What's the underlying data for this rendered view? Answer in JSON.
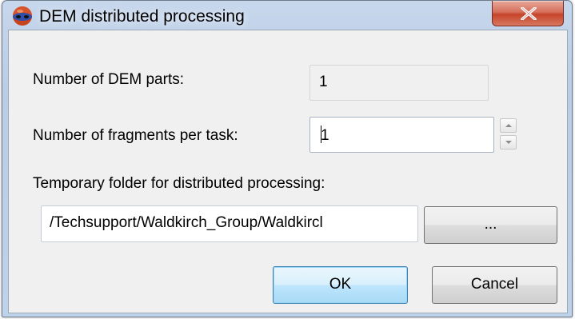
{
  "window": {
    "title": "DEM distributed processing",
    "close_symbol": "X"
  },
  "form": {
    "dem_parts_label": "Number of DEM parts:",
    "dem_parts_value": "1",
    "fragments_label": "Number of fragments per task:",
    "fragments_value": "1",
    "temp_folder_label": "Temporary folder for distributed processing:",
    "temp_folder_value": "/Techsupport/Waldkirch_Group/Waldkircl"
  },
  "buttons": {
    "browse_label": "...",
    "ok_label": "OK",
    "cancel_label": "Cancel"
  },
  "icons": {
    "app": "dem-globe-icon",
    "close": "close-icon",
    "spin_up": "spin-up-arrow-icon",
    "spin_down": "spin-down-arrow-icon"
  },
  "colors": {
    "title_gradient_top": "#c7d7ec",
    "client_background": "#f0f0f0",
    "close_button": "#c5452b",
    "default_button_border": "#3c7fb1"
  }
}
